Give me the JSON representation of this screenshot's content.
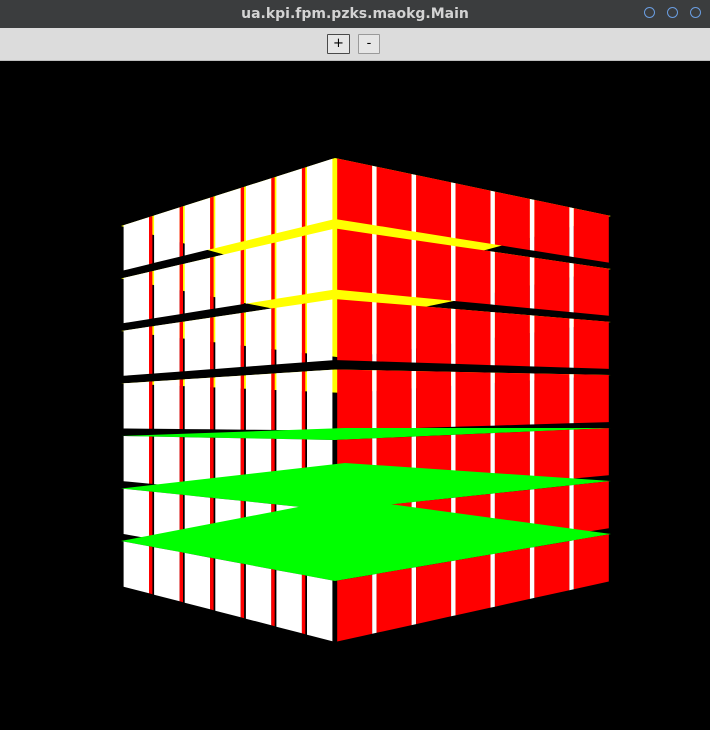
{
  "window": {
    "title": "ua.kpi.fpm.pzks.maokg.Main",
    "controls": [
      "circle-button",
      "circle-button",
      "circle-button"
    ]
  },
  "toolbar": {
    "zoom_in_label": "+",
    "zoom_out_label": "-"
  },
  "scene": {
    "object": "cube-grid",
    "layers": 7,
    "cells_per_side": 7,
    "colors": {
      "left_face": "#ffffff",
      "right_face": "#ff0000",
      "top_upper_layers": "#ffff00",
      "top_lower_layers": "#00ff00",
      "background": "#000000"
    }
  }
}
